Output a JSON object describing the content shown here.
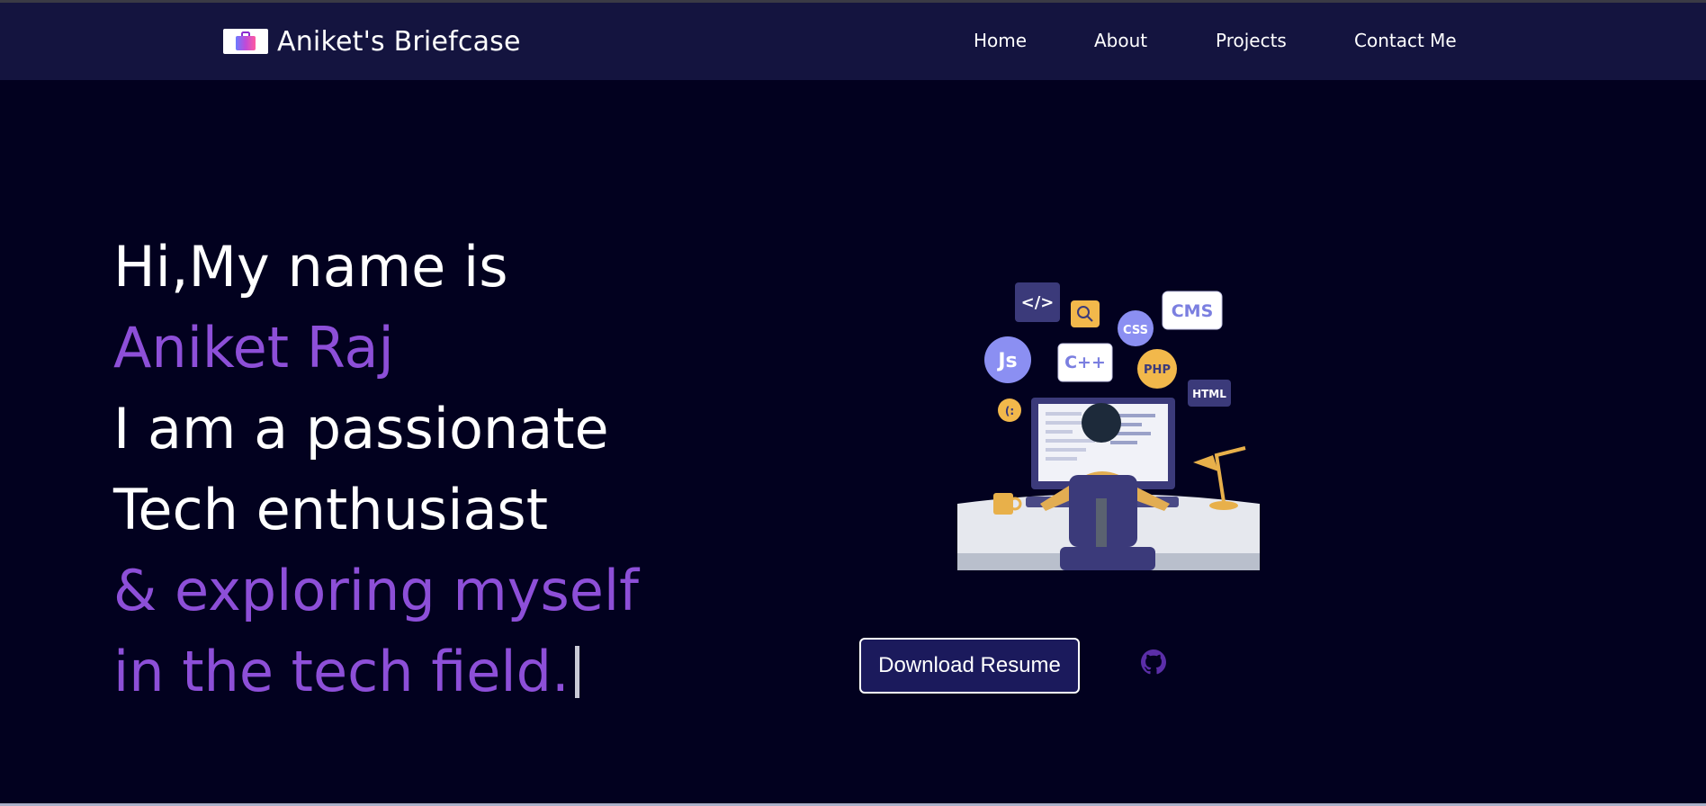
{
  "brand": {
    "name": "Aniket's Briefcase",
    "logo_icon": "briefcase-icon"
  },
  "nav": {
    "home": "Home",
    "about": "About",
    "projects": "Projects",
    "contact": "Contact Me"
  },
  "hero": {
    "line1": "Hi,My name is",
    "name": "Aniket Raj",
    "line3": "I am a passionate",
    "line4": "Tech enthusiast",
    "line5": "& exploring myself",
    "line6": "in the tech field."
  },
  "illustration": {
    "bubbles": [
      "</>",
      "CMS",
      "CSS",
      "Js",
      "C++",
      "PHP",
      "HTML",
      "(:"
    ]
  },
  "actions": {
    "resume_label": "Download Resume",
    "github_icon": "github-icon"
  },
  "colors": {
    "background": "#02011f",
    "navbar": "#14143f",
    "accent_purple": "#8d4fd8",
    "button_bg": "#1b1a5c"
  }
}
